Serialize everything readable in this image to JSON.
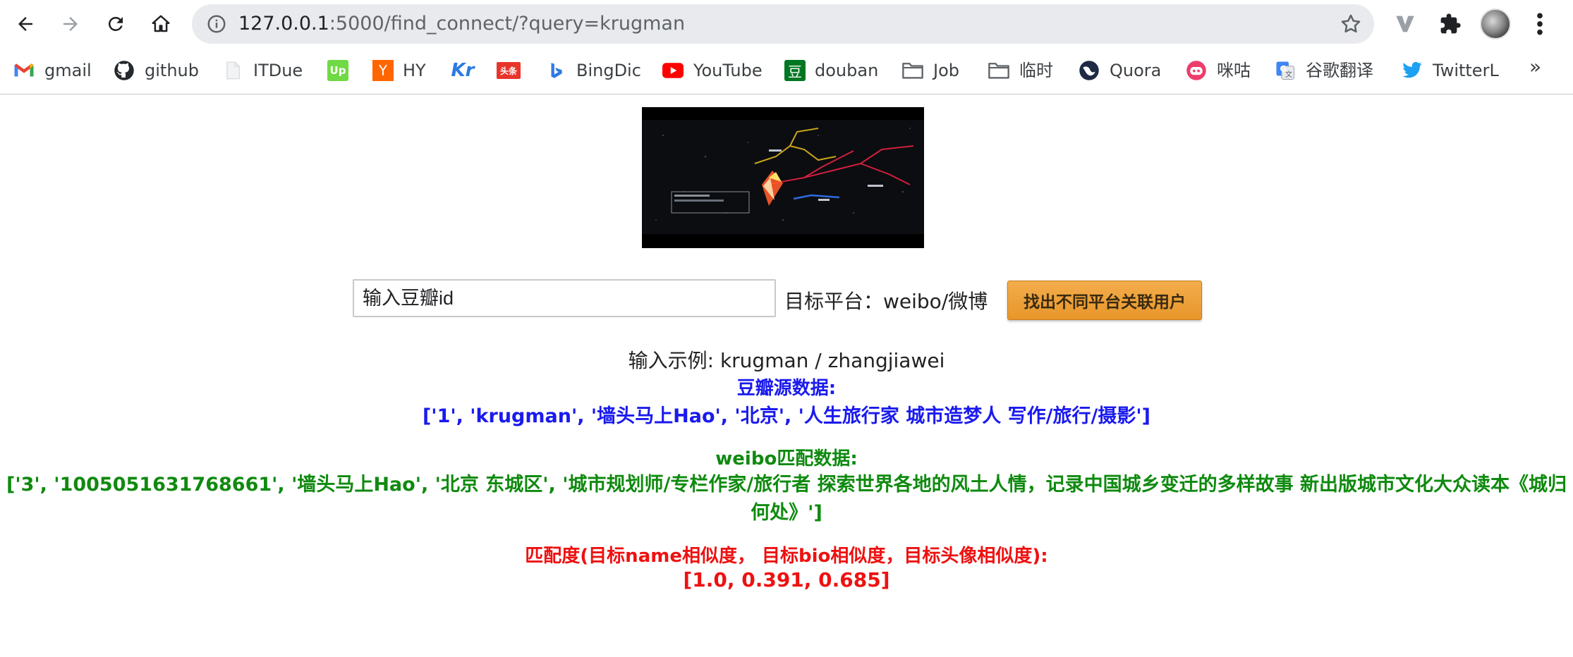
{
  "browser": {
    "url_host": "127.0.0.1",
    "url_rest": ":5000/find_connect/?query=krugman",
    "bookmarks": [
      {
        "label": "gmail",
        "icon": "gmail-icon"
      },
      {
        "label": "github",
        "icon": "github-icon"
      },
      {
        "label": "ITDue",
        "icon": "page-icon"
      },
      {
        "label": "",
        "icon": "upwork-icon"
      },
      {
        "label": "HY",
        "icon": "ycombinator-icon"
      },
      {
        "label": "",
        "icon": "kr-icon"
      },
      {
        "label": "",
        "icon": "toutiao-icon"
      },
      {
        "label": "BingDic",
        "icon": "bing-icon"
      },
      {
        "label": "YouTube",
        "icon": "youtube-icon"
      },
      {
        "label": "douban",
        "icon": "douban-icon"
      },
      {
        "label": "Job",
        "icon": "folder-icon"
      },
      {
        "label": "临时",
        "icon": "folder-icon"
      },
      {
        "label": "Quora",
        "icon": "quora-icon"
      },
      {
        "label": "咪咕",
        "icon": "migu-icon"
      },
      {
        "label": "谷歌翻译",
        "icon": "google-translate-icon"
      },
      {
        "label": "TwitterL",
        "icon": "twitter-icon"
      }
    ],
    "more_label": "»",
    "toutiao_text": "头条",
    "upwork_text": "Up",
    "yc_text": "Y",
    "kr_text": "Kr",
    "douban_text": "豆"
  },
  "page": {
    "search": {
      "placeholder": "输入豆瓣id",
      "target_label": "目标平台：weibo/微博",
      "button_label": "找出不同平台关联用户"
    },
    "example": "输入示例: krugman / zhangjiawei",
    "douban_title": "豆瓣源数据:",
    "douban_data": "['1', 'krugman', '墙头马上Hao', '北京', '人生旅行家 城市造梦人 写作/旅行/摄影']",
    "weibo_title": "weibo匹配数据:",
    "weibo_data": "['3', '1005051631768661', '墙头马上Hao', '北京 东城区', '城市规划师/专栏作家/旅行者 探索世界各地的风土人情，记录中国城乡变迁的多样故事 新出版城市文化大众读本《城归何处》']",
    "score_title": "匹配度(目标name相似度， 目标bio相似度，目标头像相似度):",
    "score_values": "[1.0, 0.391, 0.685]"
  },
  "colors": {
    "source": "#1a1aee",
    "match": "#0f8a0f",
    "score": "#ee1111",
    "button": "#f0a540"
  }
}
